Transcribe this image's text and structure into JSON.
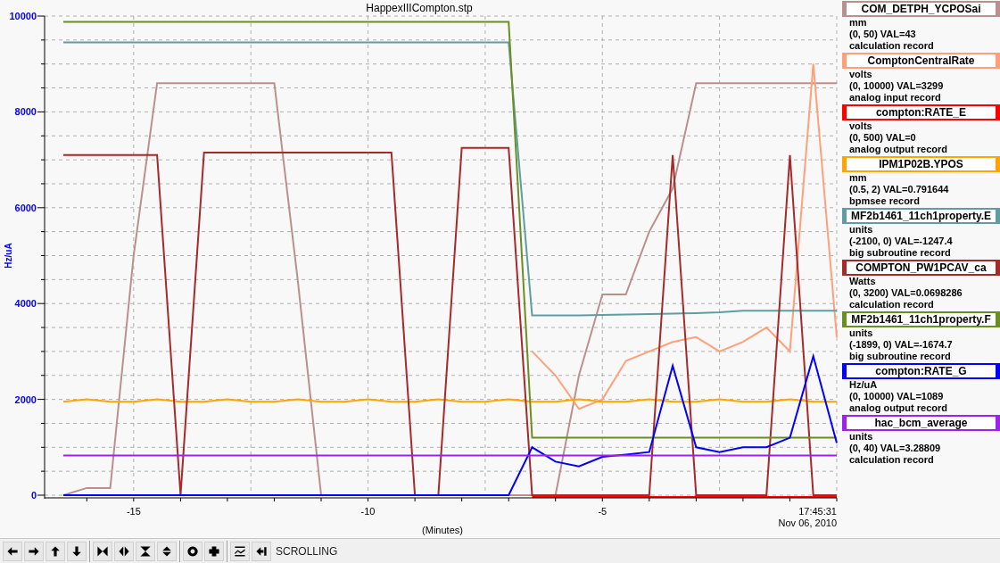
{
  "chart": {
    "chart_data": {
      "type": "line",
      "title": "HappexIIICompton.stp",
      "xlabel": "(Minutes)",
      "ylabel": "Hz/uA",
      "xlim": [
        -16.9,
        0
      ],
      "ylim": [
        0,
        10000
      ],
      "xticks": [
        -15,
        -10,
        -5
      ],
      "grid": true,
      "yticks": [
        0,
        2000,
        4000,
        6000,
        8000,
        10000
      ],
      "x": [
        -16.5,
        -16,
        -15.5,
        -15,
        -14.5,
        -14,
        -13.5,
        -13,
        -12.5,
        -12,
        -11.5,
        -11,
        -10.5,
        -10,
        -9.5,
        -9,
        -8.5,
        -8,
        -7.5,
        -7,
        -6.5,
        -6,
        -5.5,
        -5,
        -4.5,
        -4,
        -3.5,
        -3,
        -2.5,
        -2,
        -1.5,
        -1,
        -0.5,
        0
      ],
      "series": [
        {
          "name": "COM_DETPH_YCPOSai",
          "color": "#bc8f8f",
          "values": [
            0,
            150,
            150,
            5000,
            8600,
            8600,
            8600,
            8600,
            8600,
            8600,
            4500,
            0,
            0,
            0,
            0,
            0,
            0,
            0,
            0,
            0,
            0,
            0,
            2500,
            4190,
            4190,
            5500,
            6400,
            8600,
            8600,
            8600,
            8600,
            8600,
            8600,
            8600
          ]
        },
        {
          "name": "ComptonCentralRate",
          "color": "#ffa07a",
          "values": [
            null,
            null,
            null,
            null,
            null,
            null,
            null,
            null,
            null,
            null,
            null,
            null,
            null,
            null,
            null,
            null,
            null,
            null,
            null,
            null,
            3000,
            2500,
            1800,
            2000,
            2800,
            3000,
            3200,
            3300,
            3000,
            3200,
            3500,
            3000,
            9000,
            3300
          ]
        },
        {
          "name": "compton:RATE_E",
          "color": "#ff0000",
          "values": [
            null,
            null,
            null,
            null,
            null,
            null,
            null,
            null,
            null,
            null,
            null,
            null,
            null,
            null,
            null,
            null,
            null,
            null,
            null,
            null,
            0,
            0,
            0,
            0,
            0,
            0,
            0,
            0,
            0,
            0,
            0,
            0,
            0,
            0
          ]
        },
        {
          "name": "IPM1P02B.YPOS",
          "color": "#ffa500",
          "values": [
            1950,
            2000,
            1950,
            1950,
            2000,
            1950,
            1950,
            2000,
            1950,
            1950,
            2000,
            1950,
            1950,
            2000,
            1950,
            1950,
            2000,
            1950,
            1950,
            2000,
            1950,
            1950,
            2000,
            1950,
            1950,
            2000,
            1950,
            1950,
            2000,
            1950,
            1950,
            2000,
            1950,
            1950
          ]
        },
        {
          "name": "MF2b1461_11ch1property.E",
          "color": "#5f9ea0",
          "values": [
            9450,
            9450,
            9450,
            9450,
            9450,
            9450,
            9450,
            9450,
            9450,
            9450,
            9450,
            9450,
            9450,
            9450,
            9450,
            9450,
            9450,
            9450,
            9450,
            9450,
            3750,
            3750,
            3750,
            3760,
            3770,
            3780,
            3790,
            3800,
            3820,
            3850,
            3850,
            3850,
            3850,
            3850
          ]
        },
        {
          "name": "COMPTON_PW1PCAV_ca",
          "color": "#a52a2a",
          "values": [
            7100,
            7100,
            7100,
            7100,
            7100,
            0,
            7150,
            7150,
            7150,
            7150,
            7150,
            7150,
            7150,
            7150,
            7150,
            0,
            0,
            7250,
            7250,
            7250,
            0,
            0,
            0,
            0,
            0,
            0,
            7100,
            0,
            0,
            0,
            0,
            7100,
            0,
            0
          ]
        },
        {
          "name": "MF2b1461_11ch1property.F",
          "color": "#6b8e23",
          "values": [
            9880,
            9880,
            9880,
            9880,
            9880,
            9880,
            9880,
            9880,
            9880,
            9880,
            9880,
            9880,
            9880,
            9880,
            9880,
            9880,
            9880,
            9880,
            9880,
            9880,
            1200,
            1200,
            1200,
            1200,
            1200,
            1200,
            1200,
            1200,
            1200,
            1200,
            1200,
            1200,
            1200,
            1200
          ]
        },
        {
          "name": "compton:RATE_G",
          "color": "#0000ff",
          "values": [
            0,
            0,
            0,
            0,
            0,
            0,
            0,
            0,
            0,
            0,
            0,
            0,
            0,
            0,
            0,
            0,
            0,
            0,
            0,
            0,
            1000,
            700,
            600,
            800,
            850,
            900,
            2700,
            1000,
            900,
            1000,
            1000,
            1200,
            2900,
            1090
          ]
        },
        {
          "name": "hac_bcm_average",
          "color": "#a020f0",
          "values": [
            830,
            830,
            830,
            830,
            830,
            830,
            830,
            830,
            830,
            830,
            830,
            830,
            830,
            830,
            830,
            830,
            830,
            830,
            830,
            830,
            830,
            830,
            830,
            830,
            830,
            830,
            830,
            830,
            830,
            830,
            830,
            830,
            830,
            830
          ]
        }
      ]
    },
    "end_time": "17:45:31",
    "end_date": "Nov 06, 2010"
  },
  "legend": [
    {
      "units": "mm",
      "range": "(0, 50) VAL=43",
      "record": "calculation record"
    },
    {
      "units": "volts",
      "range": "(0, 10000) VAL=3299",
      "record": "analog input record"
    },
    {
      "units": "volts",
      "range": "(0, 500) VAL=0",
      "record": "analog output record"
    },
    {
      "units": "mm",
      "range": "(0.5, 2) VAL=0.791644",
      "record": "bpmsee record"
    },
    {
      "units": "units",
      "range": "(-2100, 0) VAL=-1247.4",
      "record": "big subroutine record"
    },
    {
      "units": "Watts",
      "range": "(0, 3200) VAL=0.0698286",
      "record": "calculation record"
    },
    {
      "units": "units",
      "range": "(-1899, 0) VAL=-1674.7",
      "record": "big subroutine record"
    },
    {
      "units": "Hz/uA",
      "range": "(0, 10000) VAL=1089",
      "record": "analog output record"
    },
    {
      "units": "units",
      "range": "(0, 40) VAL=3.28809",
      "record": "calculation record"
    }
  ],
  "toolbar": {
    "status": "SCROLLING"
  }
}
